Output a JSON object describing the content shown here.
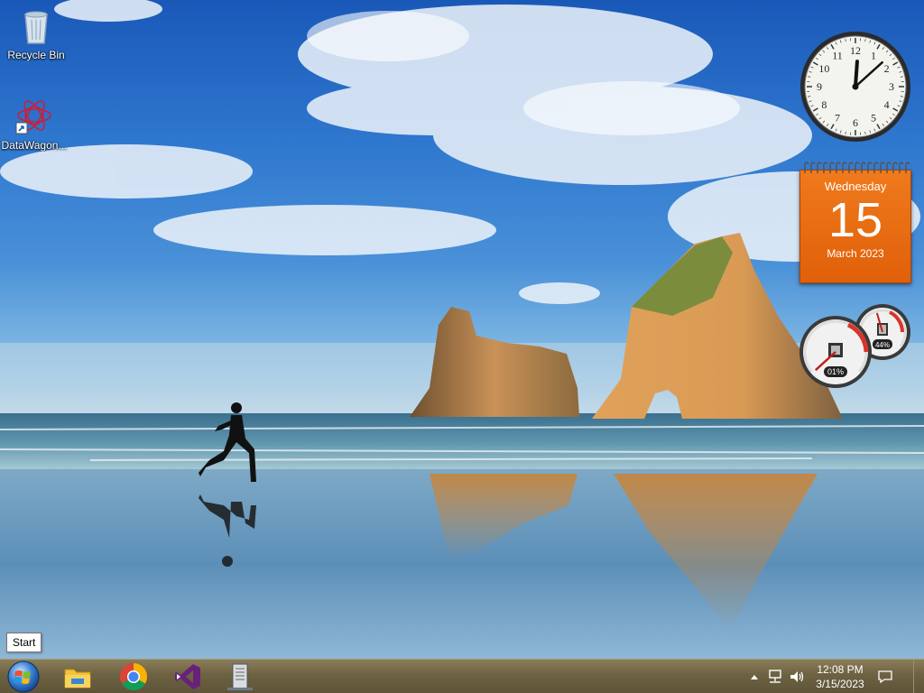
{
  "desktop": {
    "icons": [
      {
        "label": "Recycle Bin",
        "icon": "recycle-bin-icon"
      },
      {
        "label": "DataWagon...",
        "icon": "datawagon-shortcut-icon"
      }
    ]
  },
  "gadgets": {
    "clock": {
      "time_hour": 12,
      "time_minute": 8,
      "numerals": [
        "12",
        "1",
        "2",
        "3",
        "4",
        "5",
        "6",
        "7",
        "8",
        "9",
        "10",
        "11"
      ]
    },
    "calendar": {
      "weekday": "Wednesday",
      "day": "15",
      "month_year": "March 2023"
    },
    "cpu_meter": {
      "cpu_percent": "01%",
      "memory_percent": "44%",
      "cpu_value": 1,
      "memory_value": 44
    }
  },
  "tooltip": {
    "text": "Start"
  },
  "taskbar": {
    "start": {
      "label": "Start",
      "icon": "windows-orb-icon"
    },
    "pinned": [
      {
        "name": "File Explorer",
        "icon": "folder-icon"
      },
      {
        "name": "Google Chrome",
        "icon": "chrome-icon"
      },
      {
        "name": "Visual Studio",
        "icon": "visual-studio-icon"
      },
      {
        "name": "Server Manager",
        "icon": "server-icon"
      }
    ],
    "tray": {
      "icons": [
        "chevron-up-icon",
        "network-icon",
        "volume-icon"
      ],
      "time": "12:08 PM",
      "date": "3/15/2023",
      "notification_icon": "notification-icon"
    }
  }
}
